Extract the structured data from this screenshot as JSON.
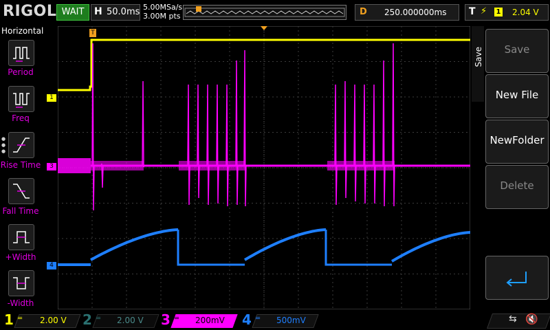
{
  "brand": {
    "logo": "RIGOL"
  },
  "status": {
    "run_state": "WAIT"
  },
  "horizontal": {
    "label": "H",
    "timebase": "50.0ms",
    "sample_rate": "5.00MSa/s",
    "memory_depth": "3.00M pts"
  },
  "delay": {
    "label": "D",
    "value": "250.000000ms"
  },
  "trigger": {
    "label": "T",
    "edge_icon": "rising-edge-icon",
    "source": "1",
    "level": "2.04 V"
  },
  "left_panel": {
    "title": "Horizontal",
    "items": [
      {
        "label": "Period",
        "icon": "period-icon"
      },
      {
        "label": "Freq",
        "icon": "frequency-icon"
      },
      {
        "label": "Rise Time",
        "icon": "rise-time-icon"
      },
      {
        "label": "Fall Time",
        "icon": "fall-time-icon"
      },
      {
        "label": "+Width",
        "icon": "positive-width-icon"
      },
      {
        "label": "-Width",
        "icon": "negative-width-icon"
      }
    ]
  },
  "right_panel": {
    "tab": "Save",
    "buttons": [
      {
        "label": "Save",
        "enabled": false
      },
      {
        "label": "New File",
        "enabled": true
      },
      {
        "label": "NewFolder",
        "enabled": true
      },
      {
        "label": "Delete",
        "enabled": false
      },
      {
        "label": "",
        "icon": "enter-return-icon",
        "enabled": true
      }
    ]
  },
  "channels": [
    {
      "number": "1",
      "scale": "2.00 V",
      "color": "#ffff00",
      "active": true
    },
    {
      "number": "2",
      "scale": "2.00 V",
      "color": "#00c0c0",
      "active": false
    },
    {
      "number": "3",
      "scale": "200mV",
      "color": "#ff00ff",
      "active": true
    },
    {
      "number": "4",
      "scale": "500mV",
      "color": "#1e7fff",
      "active": true
    }
  ],
  "markers": {
    "ch1": "1",
    "ch3": "3",
    "ch4": "4",
    "trigger_pos": "T"
  },
  "status_icons": {
    "usb": "usb-icon",
    "sound": "speaker-muted-icon"
  },
  "colors": {
    "ch1": "#ffff00",
    "ch3": "#ff00ff",
    "ch4": "#1e7fff",
    "trigger": "#f0a020",
    "grid": "#4a4a4a"
  }
}
